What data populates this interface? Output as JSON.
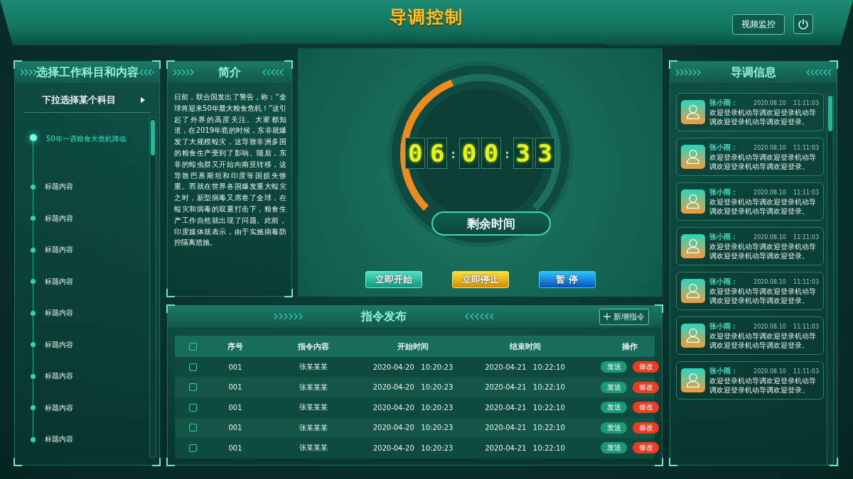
{
  "header": {
    "title": "导调控制",
    "buttons": [
      {
        "label": "视频监控"
      }
    ]
  },
  "subject_panel": {
    "title": "选择工作科目和内容",
    "dropdown": "下拉选择某个科目",
    "items": [
      {
        "label": "50年一遇粮食大危机降临",
        "selected": true
      },
      {
        "label": "标题内容",
        "selected": false
      },
      {
        "label": "标题内容",
        "selected": false
      },
      {
        "label": "标题内容",
        "selected": false
      },
      {
        "label": "标题内容",
        "selected": false
      },
      {
        "label": "标题内容",
        "selected": false
      },
      {
        "label": "标题内容",
        "selected": false
      },
      {
        "label": "标题内容",
        "selected": false
      },
      {
        "label": "标题内容",
        "selected": false
      },
      {
        "label": "标题内容",
        "selected": false
      }
    ]
  },
  "intro_panel": {
    "title": "简介",
    "text": "日前，联合国发出了警告，称：“全球将迎来50年最大粮食危机！”这引起了外界的高度关注。大家都知道，在2019年底的时候，东非就爆发了大规模蝗灾，这导致非洲多国的粮食生产受到了影响。随后，东非的蝗虫群又开始向南亚转移，这导致巴基斯坦和印度等国损失惨重。而就在世界各国爆发重大蝗灾之时，新型病毒又席卷了全球，在蝗灾和病毒的双重打击下，粮食生产工作自然就出现了问题。此前，印度媒体就表示，由于实施病毒防控隔离措施。"
  },
  "timer": {
    "groups": [
      [
        "0",
        "6"
      ],
      [
        "0",
        "0"
      ],
      [
        "3",
        "3"
      ]
    ],
    "separator": ":",
    "level": 0.42,
    "label": "剩余时间",
    "buttons": [
      {
        "label": "立即开始",
        "kind": "start"
      },
      {
        "label": "立即停止",
        "kind": "stop"
      },
      {
        "label": "暂 停",
        "kind": "pause"
      }
    ]
  },
  "command_panel": {
    "title": "指令发布",
    "add_button": "新增指令",
    "columns": [
      "序号",
      "指令内容",
      "开始时间",
      "结束时间",
      "操作"
    ],
    "header_checked": false,
    "rows": [
      {
        "checked": false,
        "no": "001",
        "content": "张某某某",
        "start": "2020-04-20   10:20:23",
        "end": "2020-04-21   10:22:10",
        "actions": [
          "发送",
          "修改"
        ]
      },
      {
        "checked": false,
        "no": "001",
        "content": "张某某某",
        "start": "2020-04-20   10:20:23",
        "end": "2020-04-21   10:22:10",
        "actions": [
          "发送",
          "修改"
        ]
      },
      {
        "checked": false,
        "no": "001",
        "content": "张某某某",
        "start": "2020-04-20   10:20:23",
        "end": "2020-04-21   10:22:10",
        "actions": [
          "发送",
          "修改"
        ]
      },
      {
        "checked": false,
        "no": "001",
        "content": "张某某某",
        "start": "2020-04-20   10:20:23",
        "end": "2020-04-21   10:22:10",
        "actions": [
          "发送",
          "修改"
        ]
      },
      {
        "checked": false,
        "no": "001",
        "content": "张某某某",
        "start": "2020-04-20   10:20:23",
        "end": "2020-04-21   10:22:10",
        "actions": [
          "发送",
          "修改"
        ]
      }
    ]
  },
  "info_panel": {
    "title": "导调信息",
    "messages": [
      {
        "name": "张小雨：",
        "time": "2020.08.10    11:11:03",
        "text": "欢迎登录机动导调欢迎登录机动导调欢迎登录机动导调欢迎登录。"
      },
      {
        "name": "张小雨：",
        "time": "2020.08.10    11:11:03",
        "text": "欢迎登录机动导调欢迎登录机动导调欢迎登录机动导调欢迎登录。"
      },
      {
        "name": "张小雨：",
        "time": "2020.08.10    11:11:03",
        "text": "欢迎登录机动导调欢迎登录机动导调欢迎登录机动导调欢迎登录。"
      },
      {
        "name": "张小雨：",
        "time": "2020.08.10    11:11:03",
        "text": "欢迎登录机动导调欢迎登录机动导调欢迎登录机动导调欢迎登录。"
      },
      {
        "name": "张小雨：",
        "time": "2020.08.10    11:11:03",
        "text": "欢迎登录机动导调欢迎登录机动导调欢迎登录机动导调欢迎登录。"
      },
      {
        "name": "张小雨：",
        "time": "2020.08.10    11:11:03",
        "text": "欢迎登录机动导调欢迎登录机动导调欢迎登录机动导调欢迎登录。"
      },
      {
        "name": "张小雨：",
        "time": "2020.08.10    11:11:03",
        "text": "欢迎登录机动导调欢迎登录机动导调欢迎登录机动导调欢迎登录。"
      }
    ]
  }
}
